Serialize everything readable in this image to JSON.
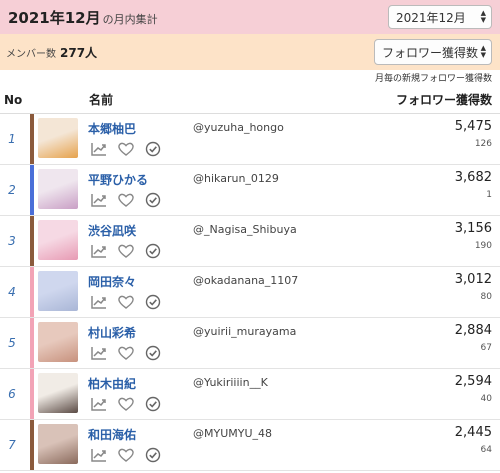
{
  "header": {
    "title_main": "2021年12月",
    "title_sub": "の月内集計",
    "month_select": "2021年12月"
  },
  "members": {
    "label": "メンバー数",
    "count": "277人",
    "sort_select": "フォロワー獲得数"
  },
  "note": "月毎の新規フォロワー獲得数",
  "table": {
    "headers": {
      "no": "No",
      "name": "名前",
      "followers": "フォロワー獲得数"
    },
    "rows": [
      {
        "rank": "1",
        "name": "本郷柚巴",
        "handle": "@yuzuha_hongo",
        "count": "5,475",
        "gain": "126",
        "bar_color": "#8b5a3c"
      },
      {
        "rank": "2",
        "name": "平野ひかる",
        "handle": "@hikarun_0129",
        "count": "3,682",
        "gain": "1",
        "bar_color": "#4a6ed8"
      },
      {
        "rank": "3",
        "name": "渋谷凪咲",
        "handle": "@_Nagisa_Shibuya",
        "count": "3,156",
        "gain": "190",
        "bar_color": "#8b5a3c"
      },
      {
        "rank": "4",
        "name": "岡田奈々",
        "handle": "@okadanana_1107",
        "count": "3,012",
        "gain": "80",
        "bar_color": "#f2a3b6"
      },
      {
        "rank": "5",
        "name": "村山彩希",
        "handle": "@yuirii_murayama",
        "count": "2,884",
        "gain": "67",
        "bar_color": "#f2a3b6"
      },
      {
        "rank": "6",
        "name": "柏木由紀",
        "handle": "@Yukiriiiin__K",
        "count": "2,594",
        "gain": "40",
        "bar_color": "#f2a3b6"
      },
      {
        "rank": "7",
        "name": "和田海佑",
        "handle": "@MYUMYU_48",
        "count": "2,445",
        "gain": "64",
        "bar_color": "#8b5a3c"
      }
    ]
  }
}
